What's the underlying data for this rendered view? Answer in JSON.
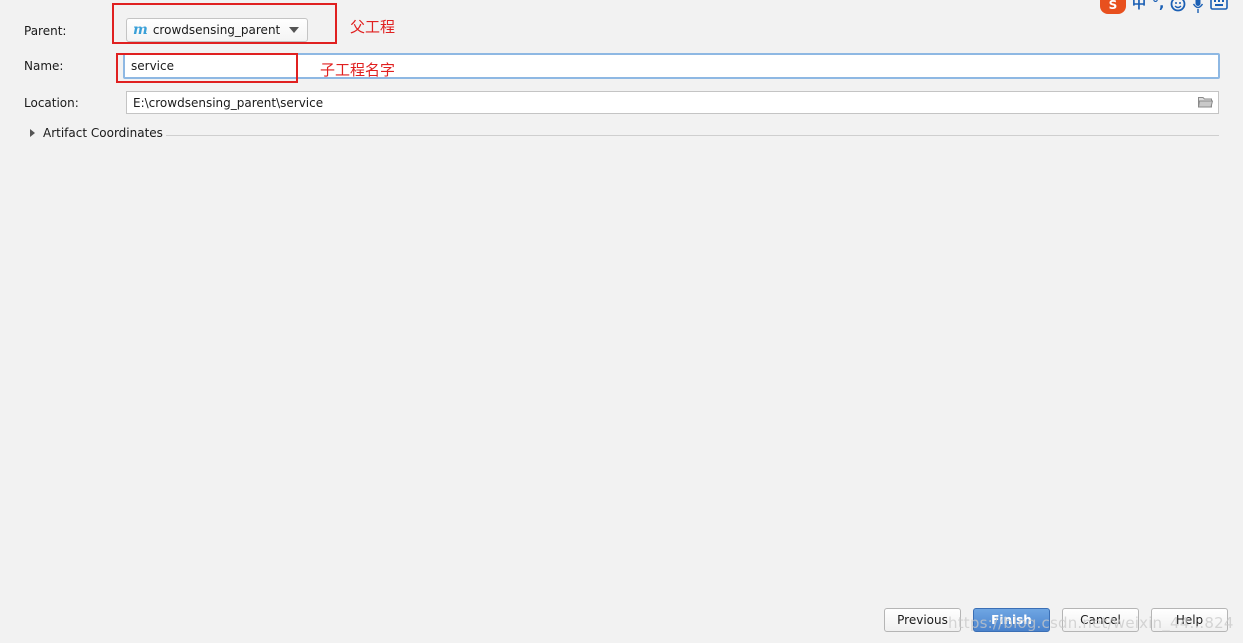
{
  "form": {
    "parent_label": "Parent:",
    "parent_value": "crowdsensing_parent",
    "parent_icon_glyph": "m",
    "name_label": "Name:",
    "name_value": "service",
    "location_label": "Location:",
    "location_value": "E:\\crowdsensing_parent\\service",
    "artifact_label": "Artifact Coordinates"
  },
  "annotations": {
    "parent_note": "父工程",
    "name_note": "子工程名字",
    "color": "#e02020"
  },
  "buttons": {
    "previous": "Previous",
    "finish": "Finish",
    "cancel": "Cancel",
    "help": "Help"
  },
  "watermark": "https://blog.csdn.net/weixin_44...824",
  "ime_toolbar": {
    "logo_glyph": "S",
    "mode_glyph": "中",
    "punct_glyph": "°,",
    "icons": [
      "smiley-icon",
      "microphone-icon",
      "keyboard-icon"
    ]
  },
  "colors": {
    "primary_button": "#4a82cc",
    "focus_border": "#8eb8e3",
    "maven_icon": "#3aa0d8",
    "ime_logo": "#e8501e"
  }
}
